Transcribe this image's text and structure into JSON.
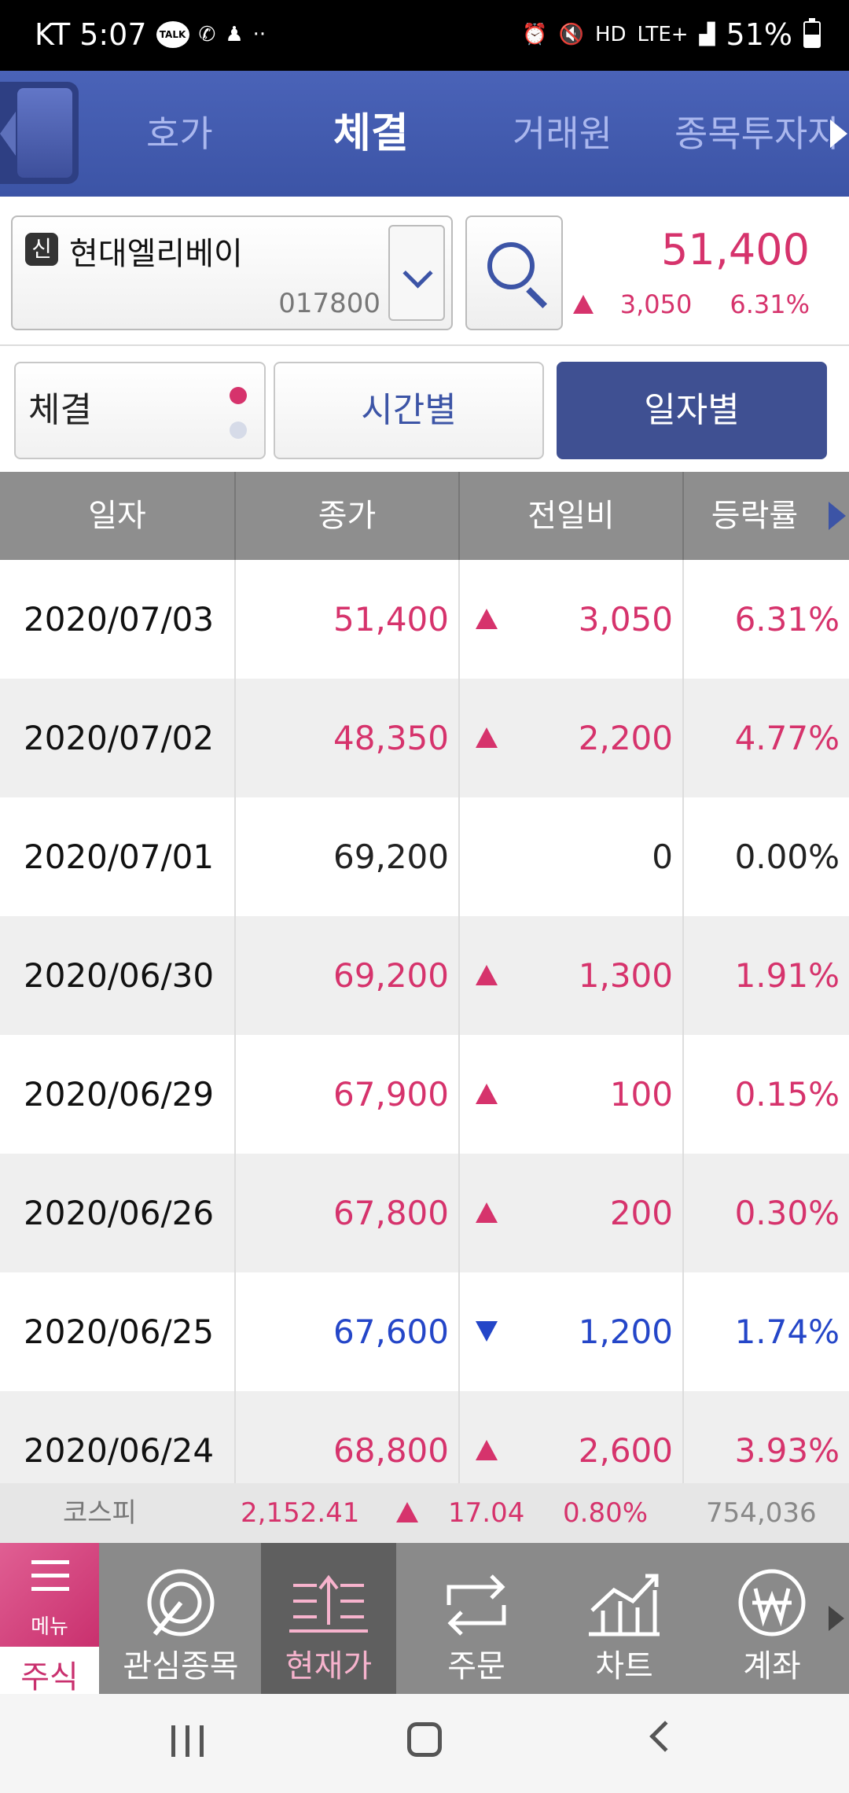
{
  "status_bar": {
    "carrier": "KT",
    "time": "5:07",
    "talk_badge": "TALK",
    "dots": "··",
    "network": "LTE+",
    "battery": "51%",
    "battery_level": 0.51
  },
  "tabs": [
    "호가",
    "체결",
    "거래원",
    "종목투자자"
  ],
  "active_tab": "체결",
  "stock": {
    "badge": "신",
    "name": "현대엘리베이",
    "code": "017800",
    "price": "51,400",
    "change": "3,050",
    "change_rate": "6.31%"
  },
  "view_buttons": {
    "trade": "체결",
    "by_time": "시간별",
    "by_date": "일자별",
    "active": "일자별"
  },
  "table": {
    "headers": [
      "일자",
      "종가",
      "전일비",
      "등락률"
    ],
    "rows": [
      {
        "date": "2020/07/03",
        "close": "51,400",
        "direction": "up",
        "diff": "3,050",
        "rate": "6.31%"
      },
      {
        "date": "2020/07/02",
        "close": "48,350",
        "direction": "up",
        "diff": "2,200",
        "rate": "4.77%"
      },
      {
        "date": "2020/07/01",
        "close": "69,200",
        "direction": "flat",
        "diff": "0",
        "rate": "0.00%"
      },
      {
        "date": "2020/06/30",
        "close": "69,200",
        "direction": "up",
        "diff": "1,300",
        "rate": "1.91%"
      },
      {
        "date": "2020/06/29",
        "close": "67,900",
        "direction": "up",
        "diff": "100",
        "rate": "0.15%"
      },
      {
        "date": "2020/06/26",
        "close": "67,800",
        "direction": "up",
        "diff": "200",
        "rate": "0.30%"
      },
      {
        "date": "2020/06/25",
        "close": "67,600",
        "direction": "down",
        "diff": "1,200",
        "rate": "1.74%"
      },
      {
        "date": "2020/06/24",
        "close": "68,800",
        "direction": "up",
        "diff": "2,600",
        "rate": "3.93%"
      }
    ]
  },
  "kospi": {
    "label": "코스피",
    "value": "2,152.41",
    "change": "17.04",
    "rate": "0.80%",
    "volume": "754,036"
  },
  "bottom_nav": {
    "menu_label": "메뉴",
    "menu_sub": "주식",
    "items": [
      "관심종목",
      "현재가",
      "주문",
      "차트",
      "계좌"
    ],
    "active": "현재가"
  },
  "colors": {
    "up": "#d6336c",
    "down": "#2446c8",
    "header_blue": "#3c54a6"
  }
}
